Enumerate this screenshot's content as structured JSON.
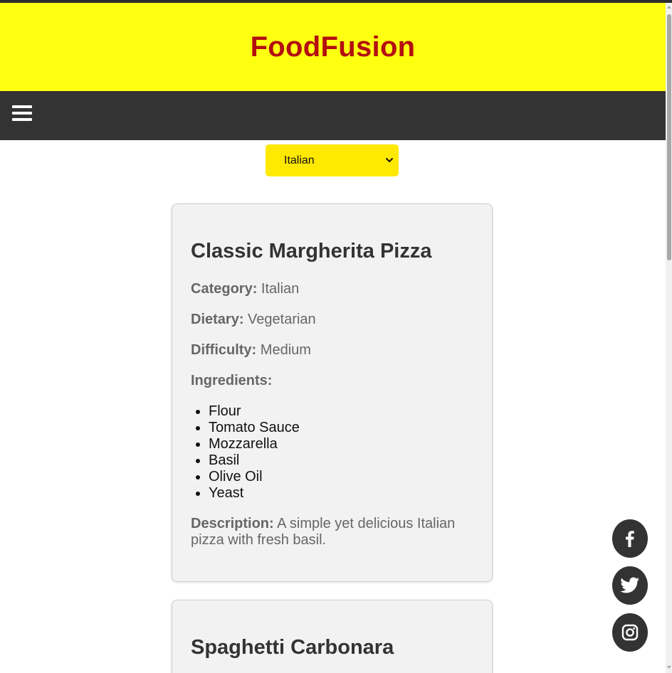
{
  "header": {
    "title": "FoodFusion"
  },
  "filter": {
    "selected": "Italian"
  },
  "recipes": [
    {
      "title": "Classic Margherita Pizza",
      "category_label": "Category:",
      "category": "Italian",
      "dietary_label": "Dietary:",
      "dietary": "Vegetarian",
      "difficulty_label": "Difficulty:",
      "difficulty": "Medium",
      "ingredients_label": "Ingredients:",
      "ingredients": [
        "Flour",
        "Tomato Sauce",
        "Mozzarella",
        "Basil",
        "Olive Oil",
        "Yeast"
      ],
      "description_label": "Description:",
      "description": "A simple yet delicious Italian pizza with fresh basil."
    },
    {
      "title": "Spaghetti Carbonara"
    }
  ],
  "social": {
    "icons": [
      "facebook-icon",
      "twitter-icon",
      "instagram-icon"
    ]
  },
  "colors": {
    "header_bg": "#ffff12",
    "title": "#b30f0f",
    "navbar": "#333333",
    "select_bg": "#ffe900",
    "card_bg": "#f2f2f2"
  }
}
